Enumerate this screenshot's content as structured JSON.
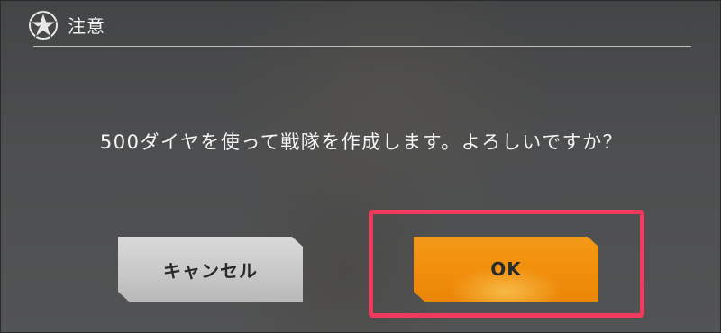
{
  "dialog": {
    "title": "注意",
    "message": "500ダイヤを使って戦隊を作成します。よろしいですか？",
    "cancel_label": "キャンセル",
    "ok_label": "OK"
  },
  "icons": {
    "logo": "star-emblem-icon"
  },
  "colors": {
    "ok_button": "#f28e0c",
    "cancel_button": "#c9c9c9",
    "highlight_box": "#ef3a5d"
  }
}
